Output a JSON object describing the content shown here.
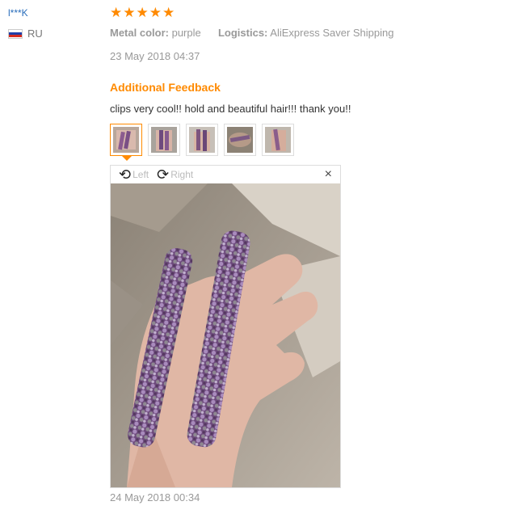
{
  "reviewer": {
    "name": "l***K",
    "country": "RU"
  },
  "review": {
    "rating": 5,
    "attributes": [
      {
        "label": "Metal color:",
        "value": "purple"
      },
      {
        "label": "Logistics:",
        "value": "AliExpress Saver Shipping"
      }
    ],
    "date": "23 May 2018 04:37"
  },
  "additional_feedback": {
    "heading": "Additional Feedback",
    "text": "clips very cool!! hold and beautiful hair!!! thank you!!",
    "thumbnail_count": 5,
    "active_thumbnail": 1,
    "viewer": {
      "rotate_left": "Left",
      "rotate_right": "Right",
      "close_symbol": "×"
    },
    "date": "24 May 2018 00:34"
  },
  "colors": {
    "accent": "#ff8a00",
    "username": "#2a6ebb",
    "muted": "#999999"
  }
}
